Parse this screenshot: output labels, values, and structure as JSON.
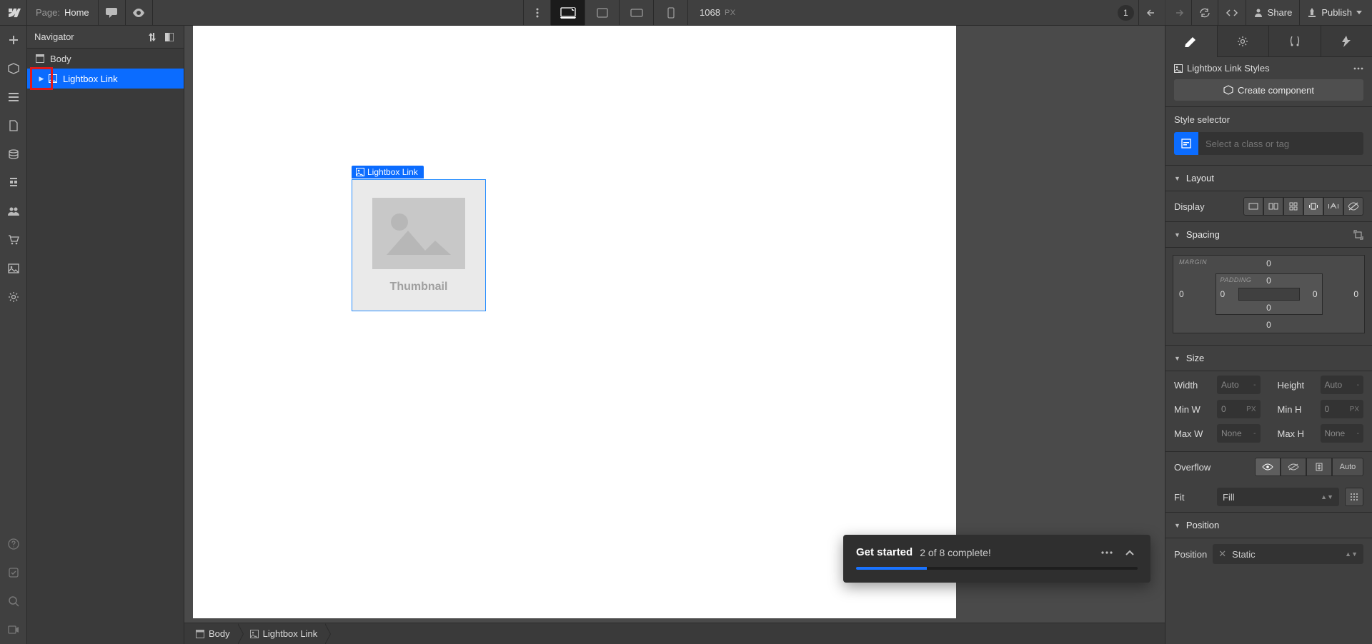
{
  "topbar": {
    "page_label": "Page:",
    "page_name": "Home",
    "canvas_width": "1068",
    "canvas_unit": "PX",
    "changes": "1",
    "share": "Share",
    "publish": "Publish"
  },
  "navigator": {
    "title": "Navigator",
    "nodes": {
      "body": "Body",
      "lightbox": "Lightbox Link"
    }
  },
  "canvas": {
    "sel_label": "Lightbox Link",
    "thumb_caption": "Thumbnail"
  },
  "toast": {
    "title": "Get started",
    "subtitle": "2 of 8 complete!",
    "progress_pct": 25
  },
  "breadcrumb": {
    "body": "Body",
    "lightbox": "Lightbox Link"
  },
  "style": {
    "header": "Lightbox Link Styles",
    "create_component": "Create component",
    "selector_label": "Style selector",
    "selector_placeholder": "Select a class or tag",
    "sections": {
      "layout": "Layout",
      "spacing": "Spacing",
      "size": "Size",
      "position": "Position"
    },
    "display_label": "Display",
    "spacing_labels": {
      "margin": "MARGIN",
      "padding": "PADDING"
    },
    "spacing_values": {
      "m_top": "0",
      "m_right": "0",
      "m_bottom": "0",
      "m_left": "0",
      "p_top": "0",
      "p_right": "0",
      "p_bottom": "0",
      "p_left": "0"
    },
    "size": {
      "width_label": "Width",
      "width_val": "Auto",
      "width_unit": "-",
      "height_label": "Height",
      "height_val": "Auto",
      "height_unit": "-",
      "minw_label": "Min W",
      "minw_val": "0",
      "minw_unit": "PX",
      "minh_label": "Min H",
      "minh_val": "0",
      "minh_unit": "PX",
      "maxw_label": "Max W",
      "maxw_val": "None",
      "maxw_unit": "-",
      "maxh_label": "Max H",
      "maxh_val": "None",
      "maxh_unit": "-"
    },
    "overflow_label": "Overflow",
    "overflow_auto": "Auto",
    "fit_label": "Fit",
    "fit_value": "Fill",
    "position_label": "Position",
    "position_value": "Static"
  }
}
